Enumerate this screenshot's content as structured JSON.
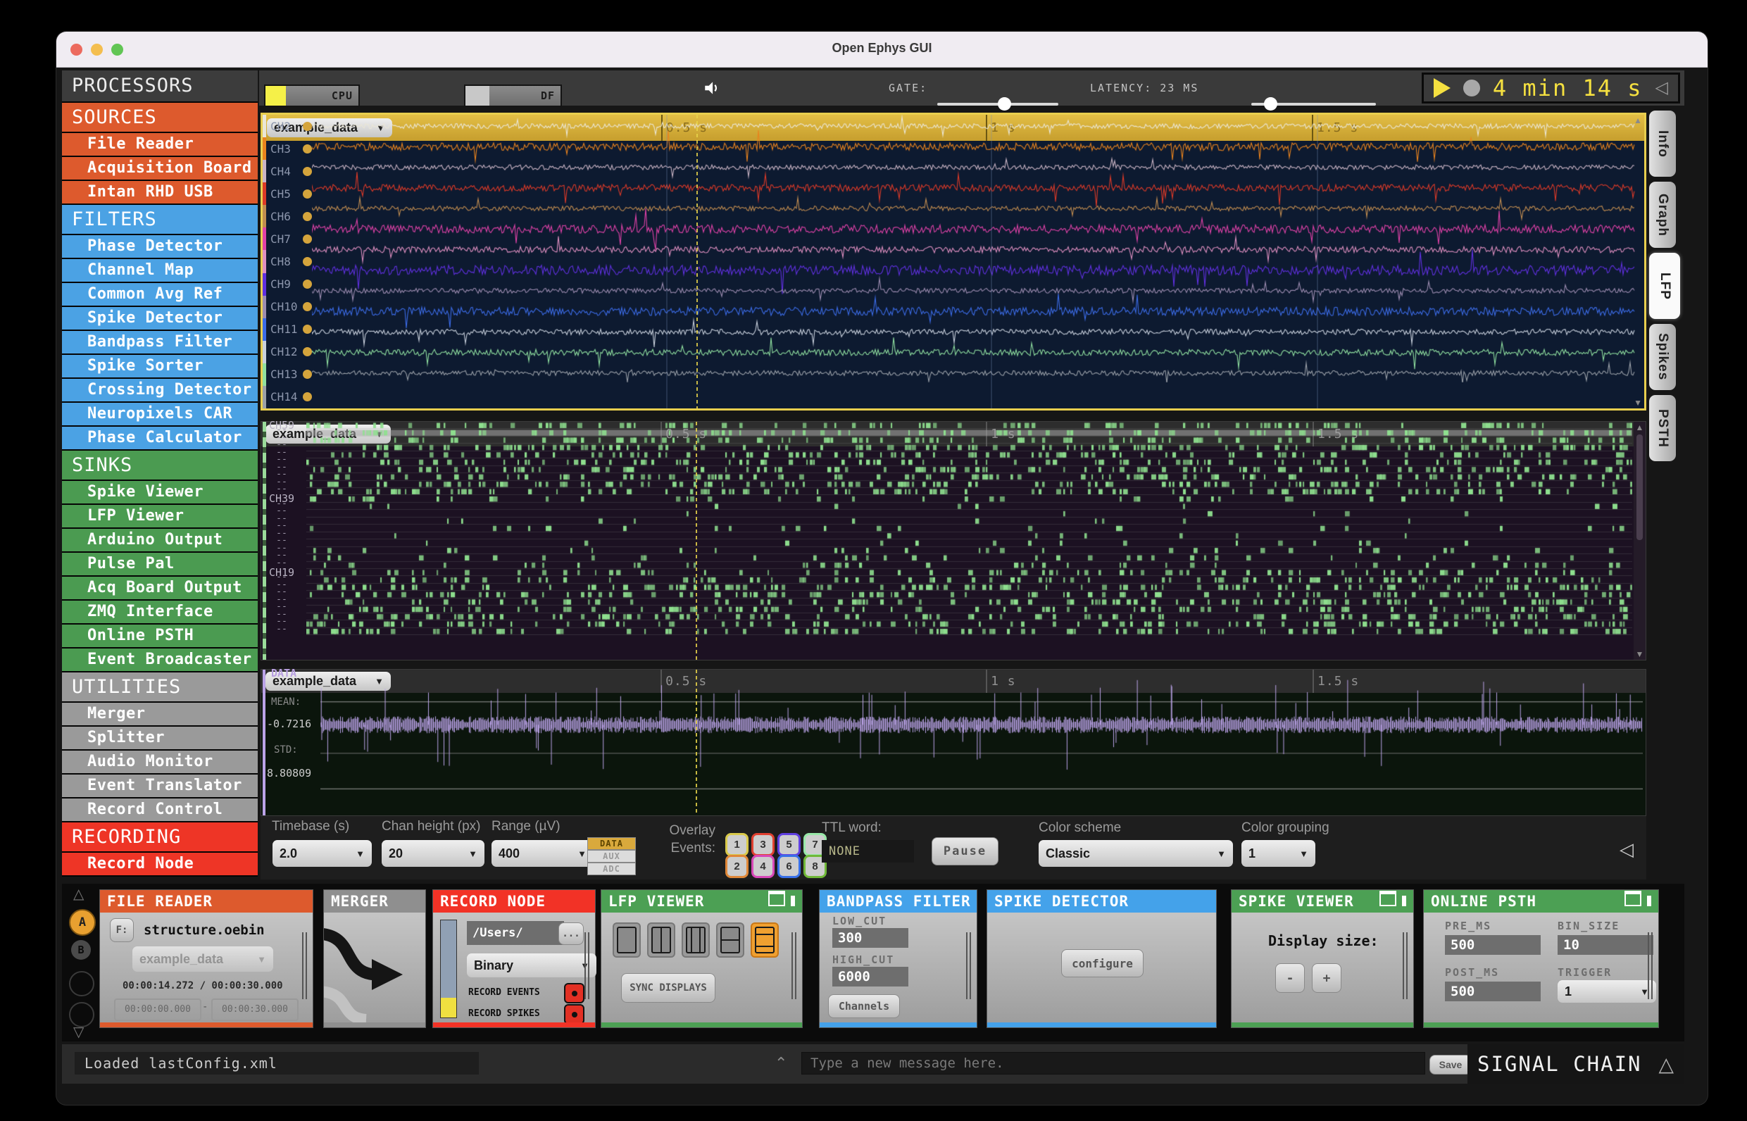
{
  "window": {
    "title": "Open Ephys GUI"
  },
  "toolbar": {
    "cpu_label": "CPU",
    "cpu_fill": 0.22,
    "df_label": "DF",
    "df_fill": 0.25,
    "gate_label": "GATE:",
    "latency": "LATENCY: 23 MS",
    "timer": "4 min 14 s",
    "collapse_glyph": "◁",
    "accent_yellow": "#F5E040"
  },
  "sidebar": {
    "title": "PROCESSORS",
    "sections": [
      {
        "label": "SOURCES",
        "color": "#DD5A2D",
        "items": [
          "File Reader",
          "Acquisition Board",
          "Intan RHD USB"
        ]
      },
      {
        "label": "FILTERS",
        "color": "#4BA2E4",
        "items": [
          "Phase Detector",
          "Channel Map",
          "Common Avg Ref",
          "Spike Detector",
          "Bandpass Filter",
          "Spike Sorter",
          "Crossing Detector",
          "Neuropixels CAR",
          "Phase Calculator"
        ]
      },
      {
        "label": "SINKS",
        "color": "#4B9B51",
        "items": [
          "Spike Viewer",
          "LFP Viewer",
          "Arduino Output",
          "Pulse Pal",
          "Acq Board Output",
          "ZMQ Interface",
          "Online PSTH",
          "Event Broadcaster"
        ]
      },
      {
        "label": "UTILITIES",
        "color": "#9A9A9A",
        "items": [
          "Merger",
          "Splitter",
          "Audio Monitor",
          "Event Translator",
          "Record Control"
        ]
      },
      {
        "label": "RECORDING",
        "color": "#EE3526",
        "items": [
          "Record Node"
        ]
      }
    ]
  },
  "time_labels": [
    "0.5 s",
    "1 s",
    "1.5 s"
  ],
  "lfp_panel": {
    "source_selector": "example_data",
    "channels": [
      {
        "name": "CH2",
        "color": "#EAE6D6"
      },
      {
        "name": "CH3",
        "color": "#E8831E"
      },
      {
        "name": "CH4",
        "color": "#C9B4C4"
      },
      {
        "name": "CH5",
        "color": "#DC3A28"
      },
      {
        "name": "CH6",
        "color": "#C08C50"
      },
      {
        "name": "CH7",
        "color": "#E042A8"
      },
      {
        "name": "CH8",
        "color": "#DE8FC0"
      },
      {
        "name": "CH9",
        "color": "#6030E0"
      },
      {
        "name": "CH10",
        "color": "#9C8CB0"
      },
      {
        "name": "CH11",
        "color": "#3C6CE8"
      },
      {
        "name": "CH12",
        "color": "#C8D0DC"
      },
      {
        "name": "CH13",
        "color": "#90E0A0"
      },
      {
        "name": "CH14",
        "color": "#9AA0A8"
      }
    ]
  },
  "raster_panel": {
    "source_selector": "example_data",
    "row_groups": [
      {
        "label": "CH59",
        "dashes": 9
      },
      {
        "label": "CH39",
        "dashes": 9
      },
      {
        "label": "CH19",
        "dashes": 8
      }
    ],
    "tick_color": "#8FE08F"
  },
  "data_panel": {
    "source_selector": "example_data",
    "title": "DATA",
    "mean_label": "MEAN:",
    "mean_value": "-0.7216",
    "std_label": "STD:",
    "std_value": "8.80809",
    "trace_color": "#BBA3E8"
  },
  "display_controls": {
    "timebase": {
      "label": "Timebase (s)",
      "value": "2.0"
    },
    "chan_height": {
      "label": "Chan height (px)",
      "value": "20"
    },
    "range": {
      "label": "Range (µV)",
      "value": "400"
    },
    "signal_types": [
      "DATA",
      "AUX",
      "ADC"
    ],
    "overlay_line1": "Overlay",
    "overlay_line2": "Events:",
    "event_buttons": [
      {
        "n": "1",
        "color": "#D9C94A"
      },
      {
        "n": "2",
        "color": "#E08838"
      },
      {
        "n": "3",
        "color": "#E04030"
      },
      {
        "n": "4",
        "color": "#D848B8"
      },
      {
        "n": "5",
        "color": "#6040E0"
      },
      {
        "n": "6",
        "color": "#3870E8"
      },
      {
        "n": "7",
        "color": "#98E8A8"
      },
      {
        "n": "8",
        "color": "#70B838"
      }
    ],
    "ttl_label": "TTL word:",
    "ttl_value": "NONE",
    "pause_label": "Pause",
    "color_scheme": {
      "label": "Color scheme",
      "value": "Classic"
    },
    "color_grouping": {
      "label": "Color grouping",
      "value": "1"
    },
    "collapse_glyph": "◁"
  },
  "chain": {
    "rail": {
      "a_label": "A",
      "b_label": "B"
    },
    "file_reader": {
      "title": "FILE READER",
      "color": "#DD5A2D",
      "f_label": "F:",
      "filename": "structure.oebin",
      "selector": "example_data",
      "time_text": "00:00:14.272 / 00:00:30.000",
      "start": "00:00:00.000",
      "dash": "-",
      "end": "00:00:30.000"
    },
    "merger": {
      "title": "MERGER",
      "color": "#8F8F8F"
    },
    "record_node": {
      "title": "RECORD NODE",
      "color": "#F23226",
      "path": "/Users/",
      "ellipsis": "...",
      "format": "Binary",
      "record_events": "RECORD EVENTS",
      "record_spikes": "RECORD SPIKES"
    },
    "lfp_viewer": {
      "title": "LFP VIEWER",
      "color": "#4CA054",
      "sync_label": "SYNC DISPLAYS"
    },
    "bandpass": {
      "title": "BANDPASS FILTER",
      "color": "#44A2EA",
      "low_label": "LOW_CUT",
      "low": "300",
      "high_label": "HIGH_CUT",
      "high": "6000",
      "channels_label": "Channels"
    },
    "spike_detector": {
      "title": "SPIKE DETECTOR",
      "color": "#44A2EA",
      "configure_label": "configure"
    },
    "spike_viewer": {
      "title": "SPIKE VIEWER",
      "color": "#4CA054",
      "display_label": "Display size:",
      "minus": "-",
      "plus": "+"
    },
    "online_psth": {
      "title": "ONLINE PSTH",
      "color": "#4CA054",
      "pre_label": "PRE_MS",
      "pre": "500",
      "bin_label": "BIN_SIZE",
      "bin": "10",
      "post_label": "POST_MS",
      "post": "500",
      "trigger_label": "TRIGGER",
      "trigger": "1"
    }
  },
  "right_tabs": [
    {
      "label": "Info",
      "active": false
    },
    {
      "label": "Graph",
      "active": false
    },
    {
      "label": "LFP",
      "active": true
    },
    {
      "label": "Spikes",
      "active": false
    },
    {
      "label": "PSTH",
      "active": false
    }
  ],
  "status_bar": {
    "message": "Loaded lastConfig.xml",
    "input_placeholder": "Type a new message here.",
    "save_label": "Save",
    "title": "SIGNAL CHAIN",
    "warning_glyph": "△",
    "chevron_glyph": "⌃"
  }
}
